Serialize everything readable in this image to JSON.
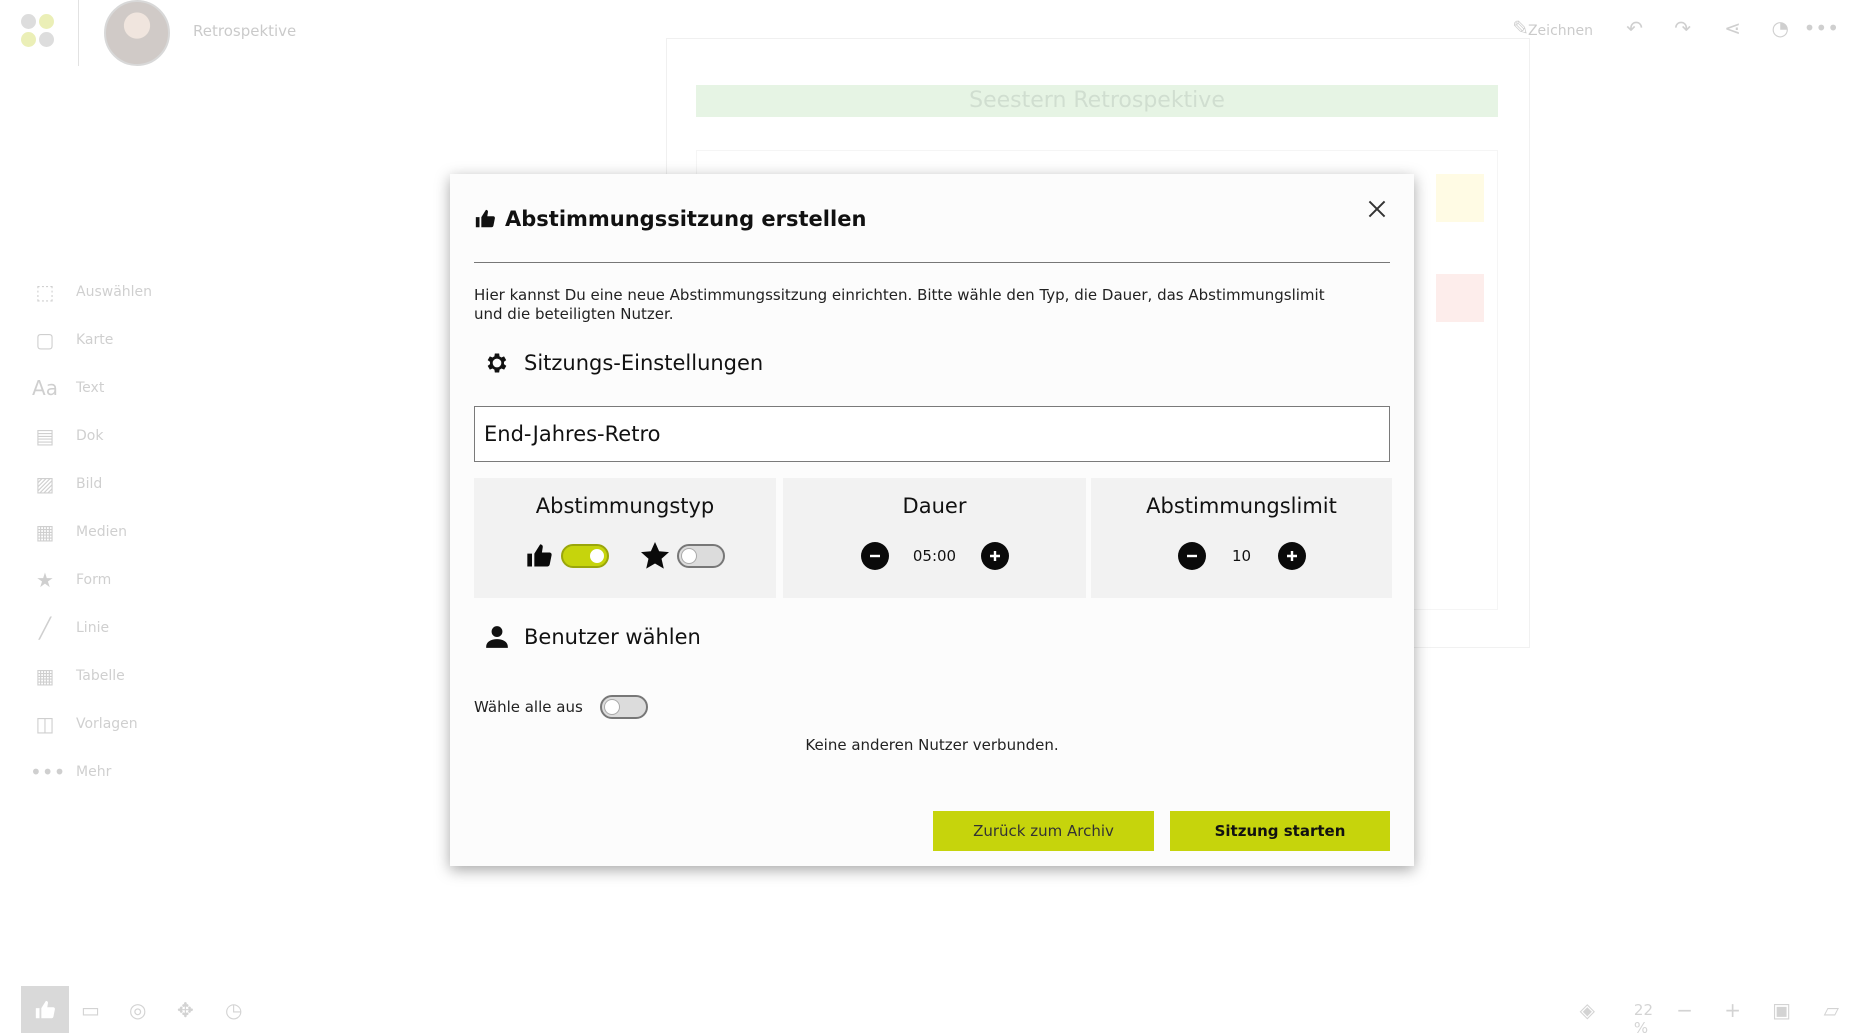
{
  "app": {
    "board_title": "Retrospektive",
    "draw_label": "Zeichnen",
    "zoom_level": "22 %",
    "canvas_title": "Seestern Retrospektive"
  },
  "toolbar": {
    "items": [
      {
        "label": "Auswählen",
        "icon": "select-icon"
      },
      {
        "label": "Karte",
        "icon": "card-icon"
      },
      {
        "label": "Text",
        "icon": "text-icon"
      },
      {
        "label": "Dok",
        "icon": "document-icon"
      },
      {
        "label": "Bild",
        "icon": "image-icon"
      },
      {
        "label": "Medien",
        "icon": "media-icon"
      },
      {
        "label": "Form",
        "icon": "shape-icon"
      },
      {
        "label": "Linie",
        "icon": "line-icon"
      },
      {
        "label": "Tabelle",
        "icon": "table-icon"
      },
      {
        "label": "Vorlagen",
        "icon": "templates-icon"
      },
      {
        "label": "Mehr",
        "icon": "more-icon"
      }
    ]
  },
  "modal": {
    "title": "Abstimmungssitzung erstellen",
    "description": "Hier kannst Du eine neue Abstimmungssitzung einrichten. Bitte wähle den Typ, die Dauer, das Abstimmungslimit und die beteiligten Nutzer.",
    "settings_heading": "Sitzungs-Einstellungen",
    "session_name": "End-Jahres-Retro",
    "vote_type": {
      "title": "Abstimmungstyp",
      "thumbs_enabled": true,
      "stars_enabled": false
    },
    "duration": {
      "title": "Dauer",
      "value": "05:00"
    },
    "vote_limit": {
      "title": "Abstimmungslimit",
      "value": "10"
    },
    "users_heading": "Benutzer wählen",
    "select_all_label": "Wähle alle aus",
    "select_all_enabled": false,
    "no_users_text": "Keine anderen Nutzer verbunden.",
    "archive_button": "Zurück zum Archiv",
    "start_button": "Sitzung starten"
  },
  "colors": {
    "accent": "#c6d40c",
    "panel_bg": "#f2f2f2"
  }
}
